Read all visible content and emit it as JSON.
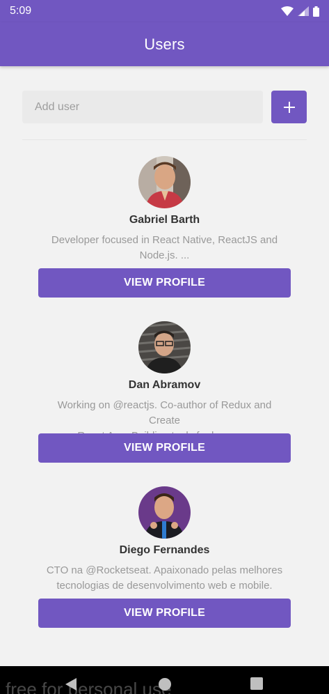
{
  "status_bar": {
    "time": "5:09",
    "icons": [
      "wifi-icon",
      "signal-icon"
    ]
  },
  "app_bar": {
    "title": "Users"
  },
  "add_form": {
    "placeholder": "Add user",
    "value": "",
    "button_icon": "plus-icon"
  },
  "users": [
    {
      "name": "Gabriel Barth",
      "bio_line1": "Developer focused in React Native, ReactJS and",
      "bio_line2": "Node.js. ...",
      "button_label": "VIEW PROFILE"
    },
    {
      "name": "Dan Abramov",
      "bio_line1": "Working on @reactjs. Co-author of Redux and Create",
      "bio_line2": "React App. Building tools for humans.",
      "button_label": "VIEW PROFILE"
    },
    {
      "name": "Diego Fernandes",
      "bio_line1": "CTO na @Rocketseat. Apaixonado pelas melhores",
      "bio_line2": "tecnologias de desenvolvimento web e mobile.",
      "button_label": "VIEW PROFILE"
    }
  ],
  "nav_bar": {
    "watermark": "free for personal use",
    "buttons": [
      "back-icon",
      "home-icon",
      "recents-icon"
    ]
  },
  "colors": {
    "primary": "#7157c1",
    "background": "#f2f2f2",
    "name_text": "#333333",
    "bio_text": "#999999"
  }
}
